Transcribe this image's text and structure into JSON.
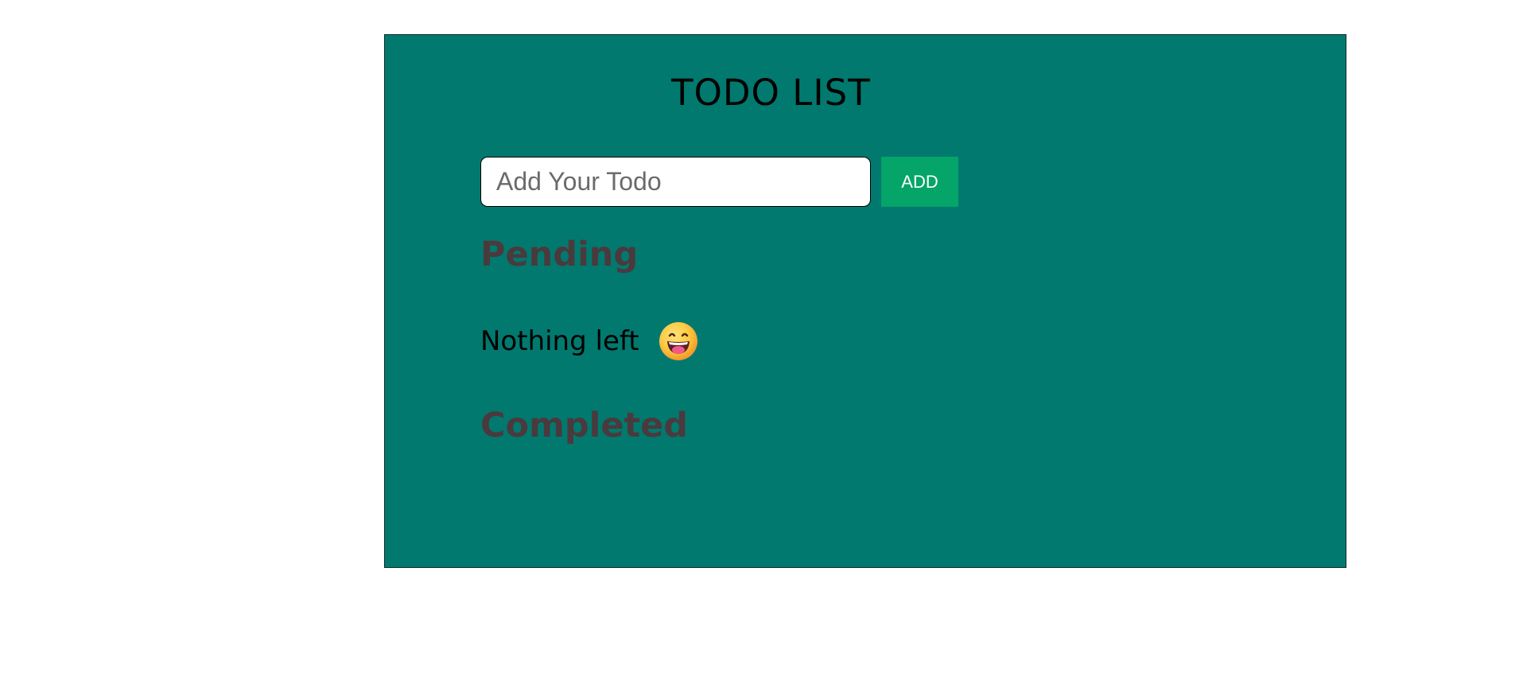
{
  "app": {
    "title": "TODO LIST"
  },
  "add_form": {
    "input_placeholder": "Add Your Todo",
    "input_value": "",
    "add_label": "ADD"
  },
  "pending": {
    "heading": "Pending",
    "empty_text": "Nothing left",
    "empty_icon": "grinning-face-with-tongue-icon"
  },
  "completed": {
    "heading": "Completed"
  },
  "colors": {
    "panel_background": "#01796f",
    "add_button": "#05a468",
    "section_heading": "#4a3a3d"
  }
}
